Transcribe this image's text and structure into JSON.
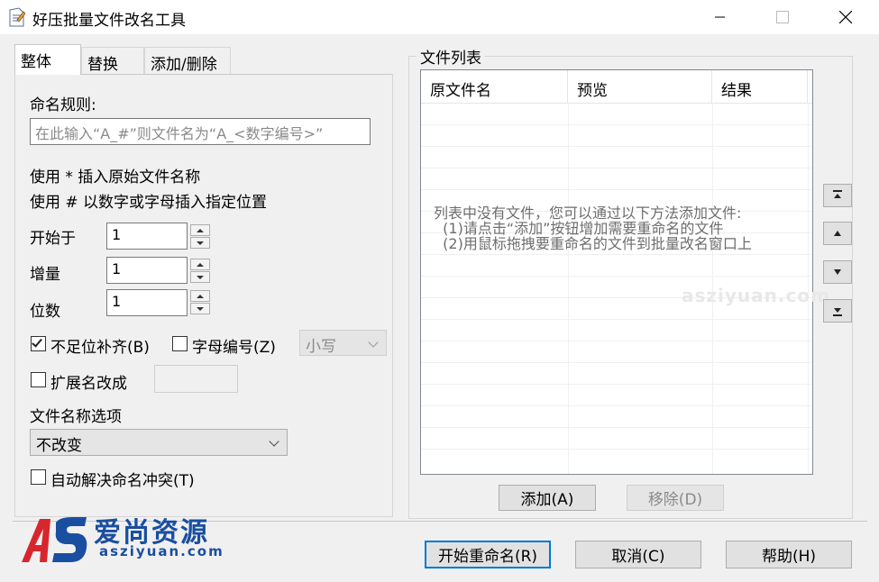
{
  "window": {
    "title": "好压批量文件改名工具",
    "minimize_icon": "minimize-icon",
    "maximize_icon": "maximize-icon",
    "close_icon": "close-icon"
  },
  "tabs": [
    {
      "label": "整体",
      "active": true
    },
    {
      "label": "替换",
      "active": false
    },
    {
      "label": "添加/删除",
      "active": false
    }
  ],
  "naming": {
    "rule_label": "命名规则:",
    "rule_placeholder": "在此输入“A_#”则文件名为“A_<数字编号>”",
    "hint1": "使用 * 插入原始文件名称",
    "hint2": "使用 # 以数字或字母插入指定位置",
    "start_label": "开始于",
    "start_value": "1",
    "step_label": "增量",
    "step_value": "1",
    "digits_label": "位数",
    "digits_value": "1",
    "pad_label": "不足位补齐(B)",
    "pad_checked": true,
    "alpha_label": "字母编号(Z)",
    "alpha_checked": false,
    "case_value": "小写",
    "ext_label": "扩展名改成",
    "ext_checked": false,
    "ext_value": "",
    "name_option_label": "文件名称选项",
    "name_option_value": "不改变",
    "conflict_label": "自动解决命名冲突(T)",
    "conflict_checked": false
  },
  "filelist": {
    "group_label": "文件列表",
    "columns": [
      "原文件名",
      "预览",
      "结果"
    ],
    "empty_line1": "列表中没有文件，您可以通过以下方法添加文件:",
    "empty_line2": "  (1)请点击“添加”按钮增加需要重命名的文件",
    "empty_line3": "  (2)用鼠标拖拽要重命名的文件到批量改名窗口上",
    "add_label": "添加(A)",
    "remove_label": "移除(D)"
  },
  "side_buttons": [
    "move-top-icon",
    "move-up-icon",
    "move-down-icon",
    "move-bottom-icon"
  ],
  "footer": {
    "start_label": "开始重命名(R)",
    "cancel_label": "取消(C)",
    "help_label": "帮助(H)"
  },
  "watermark": {
    "logo_cn": "爱尚资源",
    "logo_en": "asziyuan.com",
    "faint": "asziyuan.com"
  },
  "colors": {
    "accent": "#0078d7",
    "logo_blue": "#1a4ea0",
    "logo_red": "#d8262e"
  }
}
